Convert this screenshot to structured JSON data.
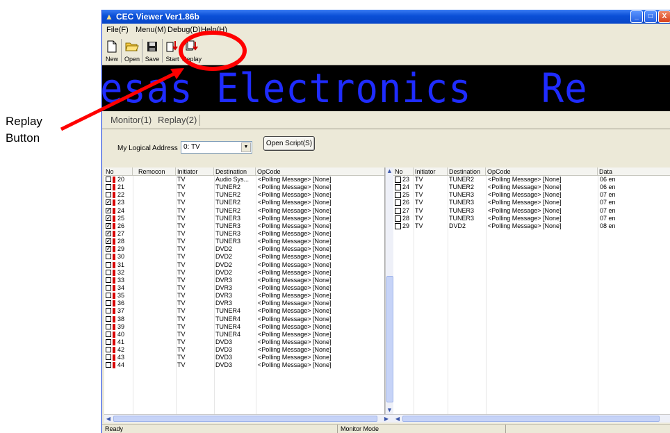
{
  "annotation": {
    "label_line1": "Replay",
    "label_line2": "Button",
    "highlight_color": "#ff0000"
  },
  "window": {
    "title": "CEC Viewer Ver1.86b",
    "controls": {
      "minimize": "_",
      "maximize": "□",
      "close": "X"
    }
  },
  "menu": {
    "file": "File(F)",
    "menu": "Menu(M)",
    "debug": "Debug(D)",
    "help": "Help(H)"
  },
  "toolbar": {
    "new": "New",
    "open": "Open",
    "save": "Save",
    "start": "Start",
    "replay": "Replay"
  },
  "banner": {
    "text": "esas Electronics   Re",
    "color": "#1f2cff"
  },
  "tabs": {
    "monitor": "Monitor(1)",
    "replay": "Replay(2)"
  },
  "address": {
    "label": "My Logical Address",
    "value": "0: TV",
    "open_script": "Open Script(S)"
  },
  "left_table": {
    "headers": [
      "No",
      "Remocon",
      "Initiator",
      "Destination",
      "OpCode"
    ],
    "rows": [
      {
        "no": "20",
        "checked": false,
        "initiator": "TV",
        "destination": "Audio Sys...",
        "opcode": "<Polling Message> [None]"
      },
      {
        "no": "21",
        "checked": false,
        "initiator": "TV",
        "destination": "TUNER2",
        "opcode": "<Polling Message> [None]"
      },
      {
        "no": "22",
        "checked": false,
        "initiator": "TV",
        "destination": "TUNER2",
        "opcode": "<Polling Message> [None]"
      },
      {
        "no": "23",
        "checked": true,
        "initiator": "TV",
        "destination": "TUNER2",
        "opcode": "<Polling Message> [None]"
      },
      {
        "no": "24",
        "checked": true,
        "initiator": "TV",
        "destination": "TUNER2",
        "opcode": "<Polling Message> [None]"
      },
      {
        "no": "25",
        "checked": true,
        "initiator": "TV",
        "destination": "TUNER3",
        "opcode": "<Polling Message> [None]"
      },
      {
        "no": "26",
        "checked": true,
        "initiator": "TV",
        "destination": "TUNER3",
        "opcode": "<Polling Message> [None]"
      },
      {
        "no": "27",
        "checked": true,
        "initiator": "TV",
        "destination": "TUNER3",
        "opcode": "<Polling Message> [None]"
      },
      {
        "no": "28",
        "checked": true,
        "initiator": "TV",
        "destination": "TUNER3",
        "opcode": "<Polling Message> [None]"
      },
      {
        "no": "29",
        "checked": true,
        "initiator": "TV",
        "destination": "DVD2",
        "opcode": "<Polling Message> [None]"
      },
      {
        "no": "30",
        "checked": false,
        "initiator": "TV",
        "destination": "DVD2",
        "opcode": "<Polling Message> [None]"
      },
      {
        "no": "31",
        "checked": false,
        "initiator": "TV",
        "destination": "DVD2",
        "opcode": "<Polling Message> [None]"
      },
      {
        "no": "32",
        "checked": false,
        "initiator": "TV",
        "destination": "DVD2",
        "opcode": "<Polling Message> [None]"
      },
      {
        "no": "33",
        "checked": false,
        "initiator": "TV",
        "destination": "DVR3",
        "opcode": "<Polling Message> [None]"
      },
      {
        "no": "34",
        "checked": false,
        "initiator": "TV",
        "destination": "DVR3",
        "opcode": "<Polling Message> [None]"
      },
      {
        "no": "35",
        "checked": false,
        "initiator": "TV",
        "destination": "DVR3",
        "opcode": "<Polling Message> [None]"
      },
      {
        "no": "36",
        "checked": false,
        "initiator": "TV",
        "destination": "DVR3",
        "opcode": "<Polling Message> [None]"
      },
      {
        "no": "37",
        "checked": false,
        "initiator": "TV",
        "destination": "TUNER4",
        "opcode": "<Polling Message> [None]"
      },
      {
        "no": "38",
        "checked": false,
        "initiator": "TV",
        "destination": "TUNER4",
        "opcode": "<Polling Message> [None]"
      },
      {
        "no": "39",
        "checked": false,
        "initiator": "TV",
        "destination": "TUNER4",
        "opcode": "<Polling Message> [None]"
      },
      {
        "no": "40",
        "checked": false,
        "initiator": "TV",
        "destination": "TUNER4",
        "opcode": "<Polling Message> [None]"
      },
      {
        "no": "41",
        "checked": false,
        "initiator": "TV",
        "destination": "DVD3",
        "opcode": "<Polling Message> [None]"
      },
      {
        "no": "42",
        "checked": false,
        "initiator": "TV",
        "destination": "DVD3",
        "opcode": "<Polling Message> [None]"
      },
      {
        "no": "43",
        "checked": false,
        "initiator": "TV",
        "destination": "DVD3",
        "opcode": "<Polling Message> [None]"
      },
      {
        "no": "44",
        "checked": false,
        "initiator": "TV",
        "destination": "DVD3",
        "opcode": "<Polling Message> [None]"
      }
    ]
  },
  "right_table": {
    "headers": [
      "No",
      "Initiator",
      "Destination",
      "OpCode",
      "Data"
    ],
    "rows": [
      {
        "no": "23",
        "initiator": "TV",
        "destination": "TUNER2",
        "opcode": "<Polling Message> [None]",
        "data": "06 en"
      },
      {
        "no": "24",
        "initiator": "TV",
        "destination": "TUNER2",
        "opcode": "<Polling Message> [None]",
        "data": "06 en"
      },
      {
        "no": "25",
        "initiator": "TV",
        "destination": "TUNER3",
        "opcode": "<Polling Message> [None]",
        "data": "07 en"
      },
      {
        "no": "26",
        "initiator": "TV",
        "destination": "TUNER3",
        "opcode": "<Polling Message> [None]",
        "data": "07 en"
      },
      {
        "no": "27",
        "initiator": "TV",
        "destination": "TUNER3",
        "opcode": "<Polling Message> [None]",
        "data": "07 en"
      },
      {
        "no": "28",
        "initiator": "TV",
        "destination": "TUNER3",
        "opcode": "<Polling Message> [None]",
        "data": "07 en"
      },
      {
        "no": "29",
        "initiator": "TV",
        "destination": "DVD2",
        "opcode": "<Polling Message> [None]",
        "data": "08 en"
      }
    ]
  },
  "status": {
    "left": "Ready",
    "mode": "Monitor Mode"
  }
}
